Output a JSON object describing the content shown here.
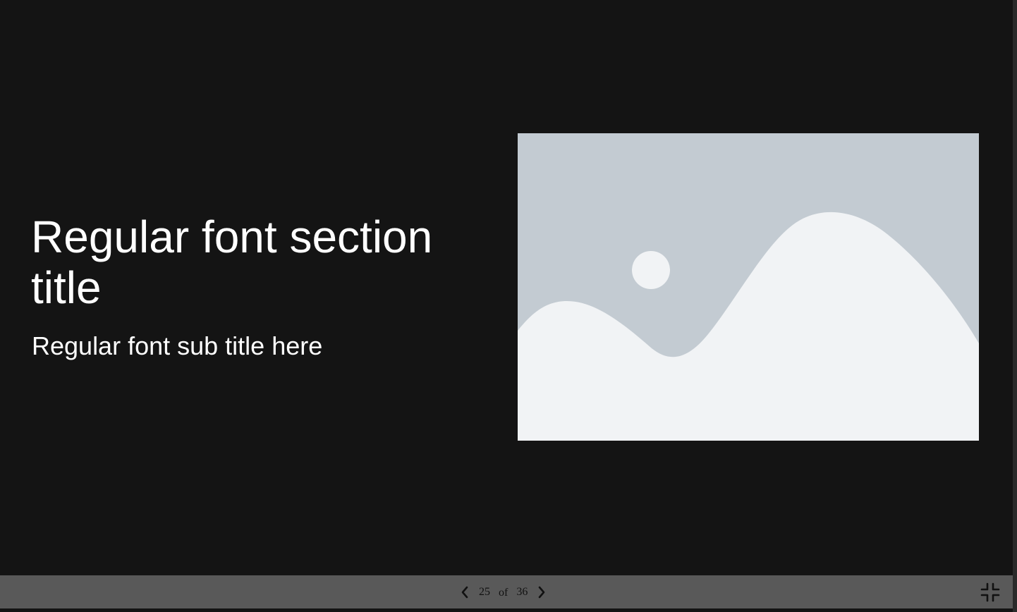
{
  "slide": {
    "title": "Regular font section title",
    "subtitle": "Regular font sub title here",
    "image": {
      "icon": "image-placeholder-icon",
      "background_color": "#c3cbd2",
      "foreground_color": "#f1f3f5"
    }
  },
  "controls": {
    "prev_icon": "chevron-left-icon",
    "next_icon": "chevron-right-icon",
    "current_page": "25",
    "of_label": "of",
    "total_pages": "36",
    "exit_fullscreen_icon": "exit-fullscreen-icon"
  },
  "colors": {
    "slide_background": "#141414",
    "text": "#ffffff",
    "control_bar": "#595959"
  }
}
